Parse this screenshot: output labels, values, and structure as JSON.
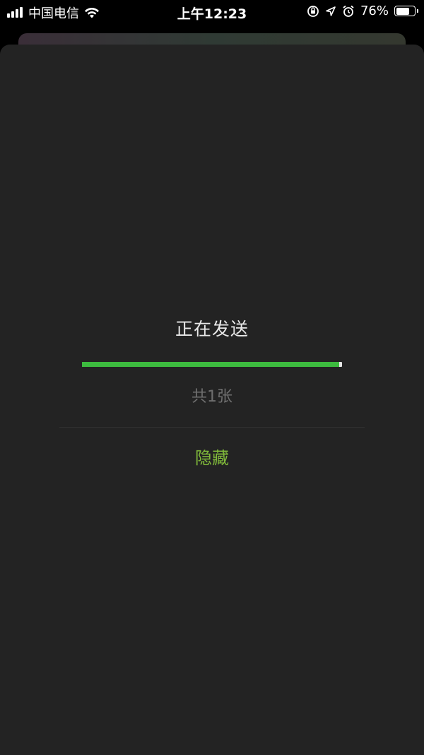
{
  "status_bar": {
    "carrier": "中国电信",
    "time": "上午12:23",
    "battery_percent_label": "76%",
    "battery_level": 0.76,
    "icons": [
      "signal-icon",
      "wifi-icon",
      "orientation-lock-icon",
      "location-icon",
      "alarm-icon",
      "battery-icon"
    ]
  },
  "dialog": {
    "title": "正在发送",
    "progress": 0.99,
    "count_text": "共1张",
    "hide_label": "隐藏"
  },
  "colors": {
    "sheet_background": "#232323",
    "progress_fill": "#3dbb3f",
    "progress_track": "#e6e6e6",
    "hide_text": "#7fb83a",
    "count_text": "#6f6f6f"
  }
}
